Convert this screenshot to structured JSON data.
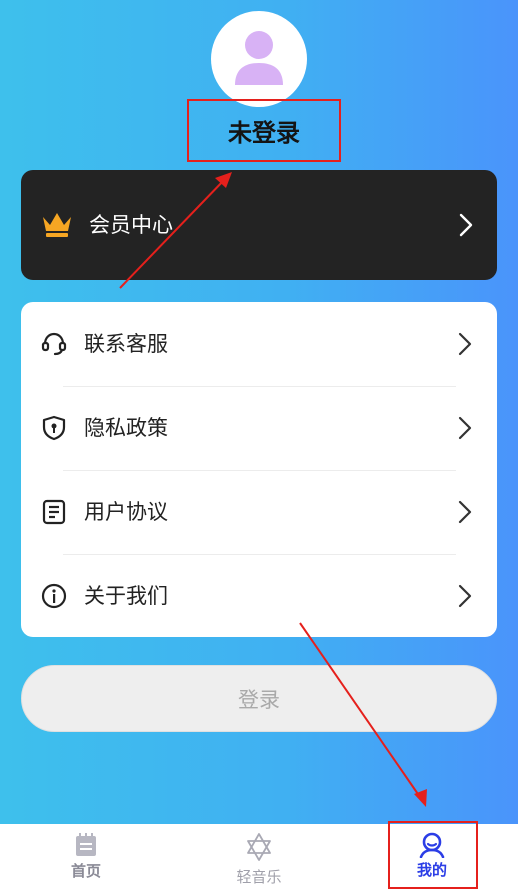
{
  "profile": {
    "username": "未登录"
  },
  "vip": {
    "label": "会员中心"
  },
  "menu": {
    "items": [
      {
        "label": "联系客服",
        "icon": "headset-icon"
      },
      {
        "label": "隐私政策",
        "icon": "shield-icon"
      },
      {
        "label": "用户协议",
        "icon": "document-icon"
      },
      {
        "label": "关于我们",
        "icon": "info-icon"
      }
    ]
  },
  "login": {
    "label": "登录"
  },
  "tabbar": {
    "tabs": [
      {
        "label": "首页",
        "icon": "notepad-icon",
        "active": false
      },
      {
        "label": "轻音乐",
        "icon": "star-icon",
        "active": false
      },
      {
        "label": "我的",
        "icon": "user-icon",
        "active": true
      }
    ]
  },
  "colors": {
    "background_start": "#3ec0ec",
    "background_end": "#4a94fb",
    "vip_card": "#232323",
    "crown": "#f6a623",
    "avatar_figure": "#d8b2f5",
    "active_tab": "#2b3de6",
    "annotation": "#e5201c"
  }
}
